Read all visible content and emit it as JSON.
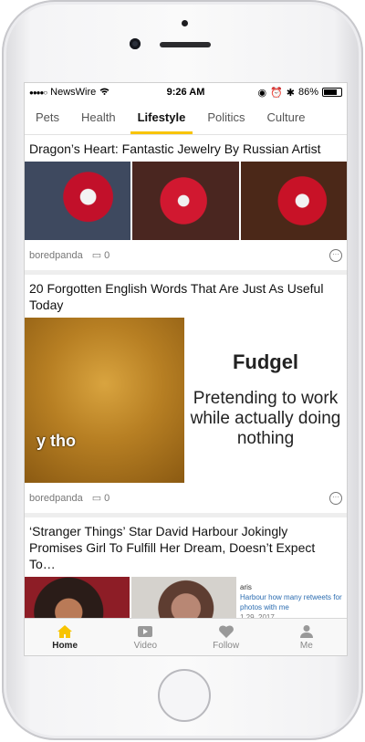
{
  "status": {
    "carrier": "NewsWire",
    "time": "9:26 AM",
    "battery": "86%",
    "battery_level": 0.86
  },
  "tabs": [
    {
      "label": "Pets"
    },
    {
      "label": "Health"
    },
    {
      "label": "Lifestyle",
      "active": true
    },
    {
      "label": "Politics"
    },
    {
      "label": "Culture"
    }
  ],
  "articles": [
    {
      "title": "Dragon’s Heart: Fantastic Jewelry By Russian Artist",
      "source": "boredpanda",
      "comments": "0"
    },
    {
      "title": "20 Forgotten English Words That Are Just As Useful Today",
      "source": "boredpanda",
      "comments": "0",
      "image_caption": "y tho",
      "side_head": "Fudgel",
      "side_body": "Pretending to work while actually doing nothing"
    },
    {
      "title": "‘Stranger Things’ Star David Harbour Jokingly Promises Girl To Fulfill Her Dream, Doesn’t Expect To…",
      "tweet_user": "aris",
      "tweet_text": "Harbour how many retweets for photos with me",
      "tweet_date": "1 29, 2017"
    }
  ],
  "tabbar": [
    {
      "label": "Home",
      "icon": "home-icon",
      "active": true
    },
    {
      "label": "Video",
      "icon": "video-icon"
    },
    {
      "label": "Follow",
      "icon": "heart-icon"
    },
    {
      "label": "Me",
      "icon": "person-icon"
    }
  ],
  "colors": {
    "accent": "#f8c400"
  }
}
